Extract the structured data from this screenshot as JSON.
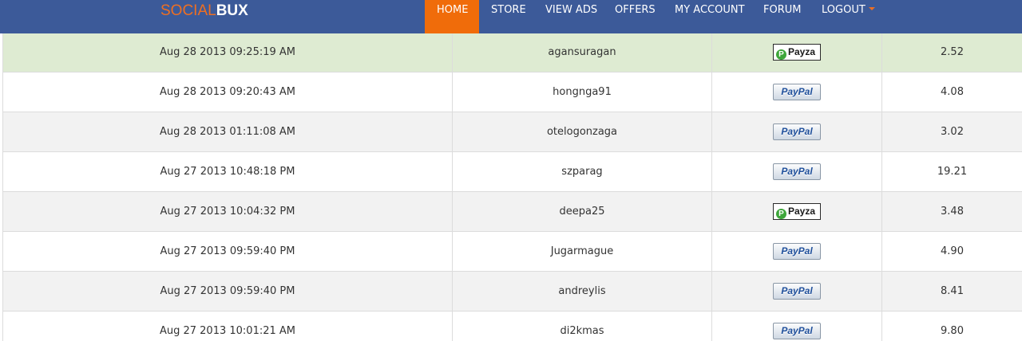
{
  "header": {
    "logo_part1": "SOCIAL",
    "logo_part2": "BUX",
    "accent_color": "#ee6f22",
    "bar_color": "#3c5a99",
    "nav": [
      {
        "label": "HOME",
        "active": true
      },
      {
        "label": "STORE",
        "active": false
      },
      {
        "label": "VIEW ADS",
        "active": false
      },
      {
        "label": "OFFERS",
        "active": false
      },
      {
        "label": "MY ACCOUNT",
        "active": false
      },
      {
        "label": "FORUM",
        "active": false
      },
      {
        "label": "LOGOUT",
        "active": false
      }
    ]
  },
  "payments": {
    "rows": [
      {
        "date": "Aug 28 2013 09:25:19 AM",
        "user": "agansuragan",
        "method": "Payza",
        "method_icon": "payza-logo-icon",
        "amount": "2.52",
        "highlight": true
      },
      {
        "date": "Aug 28 2013 09:20:43 AM",
        "user": "hongnga91",
        "method": "PayPal",
        "method_icon": "paypal-logo-icon",
        "amount": "4.08",
        "highlight": false
      },
      {
        "date": "Aug 28 2013 01:11:08 AM",
        "user": "otelogonzaga",
        "method": "PayPal",
        "method_icon": "paypal-logo-icon",
        "amount": "3.02",
        "highlight": false
      },
      {
        "date": "Aug 27 2013 10:48:18 PM",
        "user": "szparag",
        "method": "PayPal",
        "method_icon": "paypal-logo-icon",
        "amount": "19.21",
        "highlight": false
      },
      {
        "date": "Aug 27 2013 10:04:32 PM",
        "user": "deepa25",
        "method": "Payza",
        "method_icon": "payza-logo-icon",
        "amount": "3.48",
        "highlight": false
      },
      {
        "date": "Aug 27 2013 09:59:40 PM",
        "user": "Jugarmague",
        "method": "PayPal",
        "method_icon": "paypal-logo-icon",
        "amount": "4.90",
        "highlight": false
      },
      {
        "date": "Aug 27 2013 09:59:40 PM",
        "user": "andreylis",
        "method": "PayPal",
        "method_icon": "paypal-logo-icon",
        "amount": "8.41",
        "highlight": false
      },
      {
        "date": "Aug 27 2013 10:01:21 AM",
        "user": "di2kmas",
        "method": "PayPal",
        "method_icon": "paypal-logo-icon",
        "amount": "9.80",
        "highlight": false
      }
    ]
  }
}
